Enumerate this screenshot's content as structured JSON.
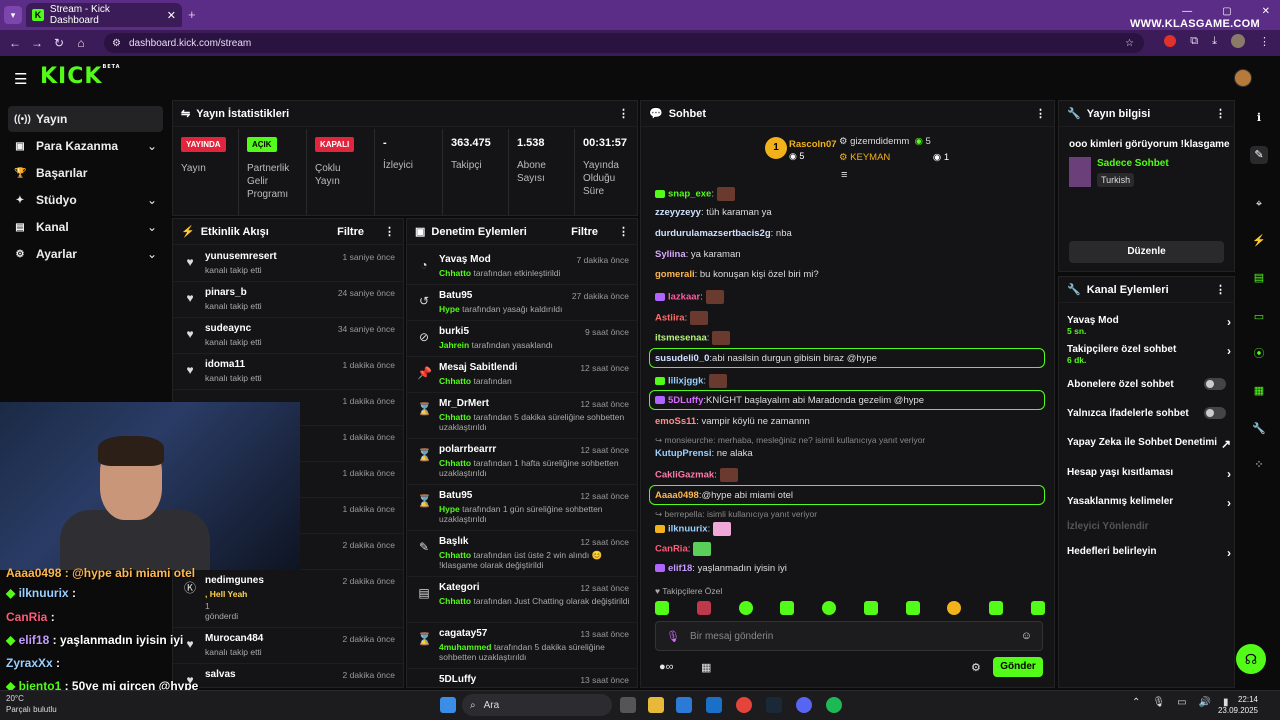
{
  "browser": {
    "tab_title": "Stream - Kick Dashboard",
    "url": "dashboard.kick.com/stream",
    "watermark": "WWW.KLASGAME.COM"
  },
  "sidebar": {
    "items": [
      {
        "label": "Yayın",
        "icon": "stream-icon"
      },
      {
        "label": "Para Kazanma",
        "icon": "money-icon"
      },
      {
        "label": "Başarılar",
        "icon": "trophy-icon"
      },
      {
        "label": "Stüdyo",
        "icon": "studio-icon"
      },
      {
        "label": "Kanal",
        "icon": "channel-icon"
      },
      {
        "label": "Ayarlar",
        "icon": "gear-icon"
      }
    ]
  },
  "stats": {
    "title": "Yayın İstatistikleri",
    "cells": [
      {
        "badge": "YAYINDA",
        "label": "Yayın"
      },
      {
        "badge": "AÇIK",
        "label": "Partnerlik Gelir Programı"
      },
      {
        "badge": "KAPALI",
        "label": "Çoklu Yayın"
      },
      {
        "value": "-",
        "label": "İzleyici"
      },
      {
        "value": "363.475",
        "label": "Takipçi"
      },
      {
        "value": "1.538",
        "label": "Abone Sayısı"
      },
      {
        "value": "00:31:57",
        "label": "Yayında Olduğu Süre"
      }
    ]
  },
  "activity": {
    "title": "Etkinlik Akışı",
    "filter": "Filtre",
    "rows": [
      {
        "name": "yunusemresert",
        "sub": "kanalı takip etti",
        "time": "1 saniye önce"
      },
      {
        "name": "pinars_b",
        "sub": "kanalı takip etti",
        "time": "24 saniye önce"
      },
      {
        "name": "sudeaync",
        "sub": "kanalı takip etti",
        "time": "34 saniye önce"
      },
      {
        "name": "idoma11",
        "sub": "kanalı takip etti",
        "time": "1 dakika önce"
      },
      {
        "name": "",
        "sub": "",
        "time": "1 dakika önce"
      },
      {
        "name": "",
        "sub": "",
        "time": "1 dakika önce"
      },
      {
        "name": "",
        "sub": "",
        "time": "1 dakika önce"
      },
      {
        "name": "",
        "sub": "",
        "time": "1 dakika önce"
      },
      {
        "name": "",
        "sub": "",
        "time": "2 dakika önce"
      },
      {
        "name": "nedimgunes",
        "sub": ", Hell Yeah",
        "extra": "1 gönderdi",
        "time": "2 dakika önce"
      },
      {
        "name": "Murocan484",
        "sub": "kanalı takip etti",
        "time": "2 dakika önce"
      },
      {
        "name": "salvas",
        "sub": "",
        "time": "2 dakika önce"
      }
    ]
  },
  "moderation": {
    "title": "Denetim Eylemleri",
    "filter": "Filtre",
    "rows": [
      {
        "name": "Yavaş Mod",
        "actor": "Chhatto",
        "sub": "tarafından etkinleştirildi",
        "time": "7 dakika önce"
      },
      {
        "name": "Batu95",
        "actor": "Hype",
        "sub": "tarafından yasağı kaldırıldı",
        "time": "27 dakika önce"
      },
      {
        "name": "burki5",
        "actor": "Jahrein",
        "sub": "tarafından yasaklandı",
        "time": "9 saat önce"
      },
      {
        "name": "Mesaj Sabitlendi",
        "actor": "Chhatto",
        "sub": "tarafından",
        "time": "12 saat önce"
      },
      {
        "name": "Mr_DrMert",
        "actor": "Chhatto",
        "sub": "tarafından 5 dakika süreliğine sohbetten uzaklaştırıldı",
        "time": "12 saat önce"
      },
      {
        "name": "polarrbearrr",
        "actor": "Chhatto",
        "sub": "tarafından 1 hafta süreliğine sohbetten uzaklaştırıldı",
        "time": "12 saat önce"
      },
      {
        "name": "Batu95",
        "actor": "Hype",
        "sub": "tarafından 1 gün süreliğine sohbetten uzaklaştırıldı",
        "time": "12 saat önce"
      },
      {
        "name": "Başlık",
        "actor": "Chhatto",
        "sub": "tarafından üst üste 2 win alındı 😊 !klasgame olarak değiştirildi",
        "time": "12 saat önce"
      },
      {
        "name": "Kategori",
        "actor": "Chhatto",
        "sub": "tarafından Just Chatting olarak değiştirildi",
        "time": "12 saat önce"
      },
      {
        "name": "cagatay57",
        "actor": "4muhammed",
        "sub": "tarafından 5 dakika süreliğine sohbetten uzaklaştırıldı",
        "time": "13 saat önce"
      },
      {
        "name": "5DLuffy",
        "actor": "",
        "sub": "",
        "time": "13 saat önce"
      }
    ]
  },
  "chat": {
    "title": "Sohbet",
    "leaders": [
      {
        "rank": "1",
        "name": "Rascoln07",
        "count": "5"
      },
      {
        "name": "gizemdidemm",
        "count": "5"
      },
      {
        "name": "KEYMAN",
        "count": "1"
      }
    ],
    "messages": [
      {
        "user": "snap_exe",
        "text": "",
        "color": "#53fc18"
      },
      {
        "user": "zzeyyzeyy",
        "text": "tüh karaman ya",
        "color": "#cfe1ff"
      },
      {
        "user": "durdurulamazsertbacis2g",
        "text": "nba",
        "color": "#cfe1ff"
      },
      {
        "user": "Syliina",
        "text": "ya karaman",
        "color": "#d8a8ff"
      },
      {
        "user": "gomerali",
        "text": "bu konuşan kişi özel biri mi?",
        "color": "#ffb84d"
      },
      {
        "user": "lazkaar",
        "text": "",
        "color": "#ff5aa0"
      },
      {
        "user": "Astiira",
        "text": "",
        "color": "#ff6b6b"
      },
      {
        "user": "itsmesenaa",
        "text": "",
        "color": "#b8f27a"
      },
      {
        "user": "susudeli0_0",
        "text": "abi nasilsin durgun gibisin biraz @hype",
        "color": "#cfe1ff"
      },
      {
        "user": "lilixjggk",
        "text": "",
        "color": "#9ad0ff"
      },
      {
        "user": "5DLuffy",
        "text": "KNİGHT başlayalım abi Maradonda gezelim @hype",
        "color": "#d86bff"
      },
      {
        "user": "emoSs11",
        "text": "vampir köylü ne zamannn",
        "color": "#ff8d8d"
      },
      {
        "user": "",
        "text": "monsieurche: merhaba, mesleğiniz ne? isimli kullanıcıya yanıt veriyor",
        "color": "#888"
      },
      {
        "user": "KutupPrensi",
        "text": "ne alaka",
        "color": "#9ad0ff"
      },
      {
        "user": "CakliGazmak",
        "text": "",
        "color": "#ff7aa8"
      },
      {
        "user": "Aaaa0498",
        "text": "@hype abi miami otel",
        "color": "#ffb84d"
      },
      {
        "user": "",
        "text": "berrepella: isimli kullanıcıya yanıt veriyor",
        "color": "#888"
      },
      {
        "user": "ilknuurix",
        "text": "",
        "color": "#9ad0ff"
      },
      {
        "user": "CanRia",
        "text": "",
        "color": "#ff5a7a"
      },
      {
        "user": "elif18",
        "text": "yaşlanmadın iyisin iyi",
        "color": "#c59bff"
      }
    ],
    "followers_label": "Takipçilere Özel",
    "input_placeholder": "Bir mesaj gönderin",
    "send_label": "Gönder"
  },
  "info": {
    "title": "Yayın bilgisi",
    "stream_title": "ooo kimleri görüyorum !klasgame",
    "category": "Sadece Sohbet",
    "tag": "Turkish",
    "edit_label": "Düzenle"
  },
  "channel_actions": {
    "title": "Kanal Eylemleri",
    "items": [
      {
        "label": "Yavaş Mod",
        "sub": "5 sn.",
        "type": "chevron"
      },
      {
        "label": "Takipçilere özel sohbet",
        "sub": "6 dk.",
        "type": "chevron"
      },
      {
        "label": "Abonelere özel sohbet",
        "type": "toggle"
      },
      {
        "label": "Yalnızca ifadelerle sohbet",
        "type": "toggle"
      },
      {
        "label": "Yapay Zeka ile Sohbet Denetimi",
        "type": "external"
      },
      {
        "label": "Hesap yaşı kısıtlaması",
        "type": "chevron"
      },
      {
        "label": "Yasaklanmış kelimeler",
        "type": "chevron"
      },
      {
        "label": "İzleyici Yönlendir",
        "type": "disabled"
      },
      {
        "label": "Hedefleri belirleyin",
        "type": "chevron"
      }
    ]
  },
  "overlay_chat": [
    {
      "user": "Aaaa0498",
      "text": "@hype abi miami otel"
    },
    {
      "user": "ilknuurix",
      "text": ":"
    },
    {
      "user": "CanRia",
      "text": ":"
    },
    {
      "user": "elif18",
      "text": ": yaşlanmadın iyisin iyi"
    },
    {
      "user": "ZyraxXx",
      "text": ":"
    },
    {
      "user": "biento1",
      "text": ": 50ye mi gircen @hype"
    }
  ],
  "taskbar": {
    "weather_temp": "20°C",
    "weather_desc": "Parçalı bulutlu",
    "search": "Ara",
    "time": "22:14",
    "date": "23.09.2025"
  }
}
